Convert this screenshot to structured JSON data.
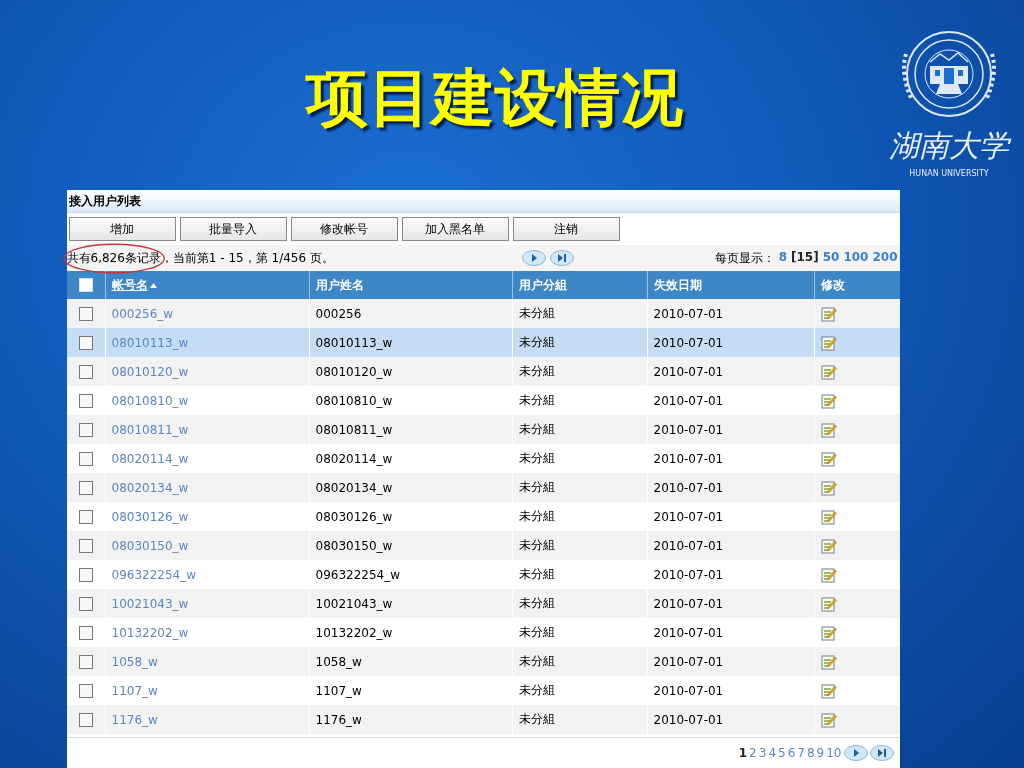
{
  "slide_title": "项目建设情况",
  "logo": {
    "name_cn": "湖南大学",
    "name_en": "HUNAN UNIVERSITY"
  },
  "panel": {
    "title": "接入用户列表",
    "buttons": [
      "增加",
      "批量导入",
      "修改帐号",
      "加入黑名单",
      "注销"
    ],
    "record_summary": {
      "circled": "共有6,826条记录",
      "rest": "，当前第1 - 15，第  1/456 页。"
    },
    "page_size": {
      "label": "每页显示：",
      "options": [
        {
          "label": "8",
          "selected": false
        },
        {
          "label": "[15]",
          "selected": true
        },
        {
          "label": "50",
          "selected": false
        },
        {
          "label": "100",
          "selected": false
        },
        {
          "label": "200",
          "selected": false
        }
      ]
    },
    "select_all_checked": false,
    "columns": [
      {
        "label": "帐号名",
        "sorted": true
      },
      {
        "label": "用户姓名",
        "sorted": false
      },
      {
        "label": "用户分組",
        "sorted": false
      },
      {
        "label": "失效日期",
        "sorted": false
      },
      {
        "label": "修改",
        "sorted": false
      }
    ],
    "rows": [
      {
        "account": "000256_w",
        "name": "000256",
        "group": "未分組",
        "expiry": "2010-07-01",
        "selected": false,
        "checked": false
      },
      {
        "account": "08010113_w",
        "name": "08010113_w",
        "group": "未分組",
        "expiry": "2010-07-01",
        "selected": true,
        "checked": false
      },
      {
        "account": "08010120_w",
        "name": "08010120_w",
        "group": "未分組",
        "expiry": "2010-07-01",
        "selected": false,
        "checked": false
      },
      {
        "account": "08010810_w",
        "name": "08010810_w",
        "group": "未分組",
        "expiry": "2010-07-01",
        "selected": false,
        "checked": false
      },
      {
        "account": "08010811_w",
        "name": "08010811_w",
        "group": "未分組",
        "expiry": "2010-07-01",
        "selected": false,
        "checked": false
      },
      {
        "account": "08020114_w",
        "name": "08020114_w",
        "group": "未分組",
        "expiry": "2010-07-01",
        "selected": false,
        "checked": false
      },
      {
        "account": "08020134_w",
        "name": "08020134_w",
        "group": "未分組",
        "expiry": "2010-07-01",
        "selected": false,
        "checked": false
      },
      {
        "account": "08030126_w",
        "name": "08030126_w",
        "group": "未分組",
        "expiry": "2010-07-01",
        "selected": false,
        "checked": false
      },
      {
        "account": "08030150_w",
        "name": "08030150_w",
        "group": "未分組",
        "expiry": "2010-07-01",
        "selected": false,
        "checked": false
      },
      {
        "account": "096322254_w",
        "name": "096322254_w",
        "group": "未分組",
        "expiry": "2010-07-01",
        "selected": false,
        "checked": false
      },
      {
        "account": "10021043_w",
        "name": "10021043_w",
        "group": "未分組",
        "expiry": "2010-07-01",
        "selected": false,
        "checked": false
      },
      {
        "account": "10132202_w",
        "name": "10132202_w",
        "group": "未分組",
        "expiry": "2010-07-01",
        "selected": false,
        "checked": false
      },
      {
        "account": "1058_w",
        "name": "1058_w",
        "group": "未分組",
        "expiry": "2010-07-01",
        "selected": false,
        "checked": false
      },
      {
        "account": "1107_w",
        "name": "1107_w",
        "group": "未分組",
        "expiry": "2010-07-01",
        "selected": false,
        "checked": false
      },
      {
        "account": "1176_w",
        "name": "1176_w",
        "group": "未分組",
        "expiry": "2010-07-01",
        "selected": false,
        "checked": false
      }
    ],
    "pages": [
      {
        "label": "1",
        "selected": true
      },
      {
        "label": "2",
        "selected": false
      },
      {
        "label": "3",
        "selected": false
      },
      {
        "label": "4",
        "selected": false
      },
      {
        "label": "5",
        "selected": false
      },
      {
        "label": "6",
        "selected": false
      },
      {
        "label": "7",
        "selected": false
      },
      {
        "label": "8",
        "selected": false
      },
      {
        "label": "9",
        "selected": false
      },
      {
        "label": "10",
        "selected": false
      }
    ]
  }
}
